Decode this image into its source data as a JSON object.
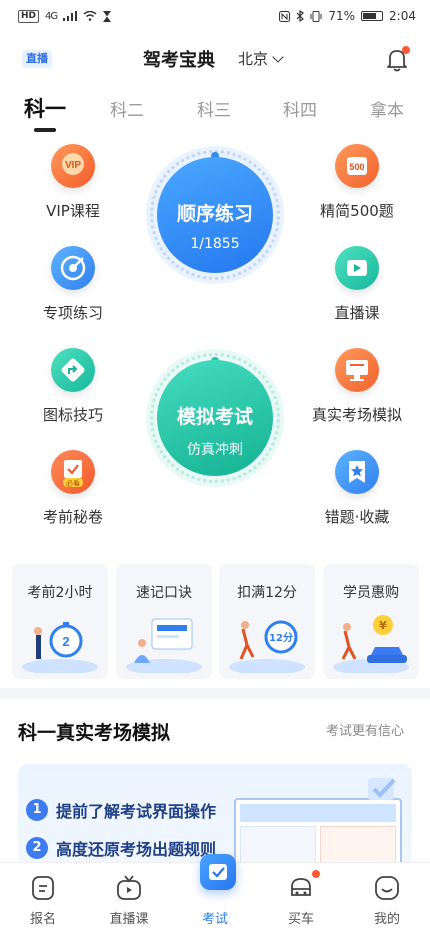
{
  "status_bar": {
    "network": "4G",
    "battery": "71%",
    "battery_level": 0.71,
    "time": "2:04"
  },
  "header": {
    "live_badge": "直播",
    "title": "驾考宝典",
    "city": "北京"
  },
  "tabs": [
    "科一",
    "科二",
    "科三",
    "科四",
    "拿本"
  ],
  "features_left": [
    "VIP课程",
    "专项练习",
    "图标技巧",
    "考前秘卷"
  ],
  "features_right": [
    "精简500题",
    "直播课",
    "真实考场模拟",
    "错题·收藏"
  ],
  "feature_badges": {
    "vip": "VIP",
    "q500": "500",
    "secret": "必看"
  },
  "practice": {
    "title": "顺序练习",
    "progress": "1/1855"
  },
  "mock_exam": {
    "title": "模拟考试",
    "subtitle": "仿真冲刺"
  },
  "cards": [
    {
      "title": "考前2小时",
      "badge": "2"
    },
    {
      "title": "速记口诀",
      "badge": ""
    },
    {
      "title": "扣满12分",
      "badge": "12分"
    },
    {
      "title": "学员惠购",
      "badge": "¥"
    }
  ],
  "section": {
    "title": "科一真实考场模拟",
    "link": "考试更有信心"
  },
  "promo": {
    "item1": "提前了解考试界面操作",
    "item2": "高度还原考场出题规则",
    "num1": "1",
    "num2": "2"
  },
  "nav": [
    "报名",
    "直播课",
    "考试",
    "买车",
    "我的"
  ],
  "colors": {
    "accent": "#2c7bf2",
    "practice_blue": "#2f8af0",
    "mock_green": "#21c5a6"
  }
}
